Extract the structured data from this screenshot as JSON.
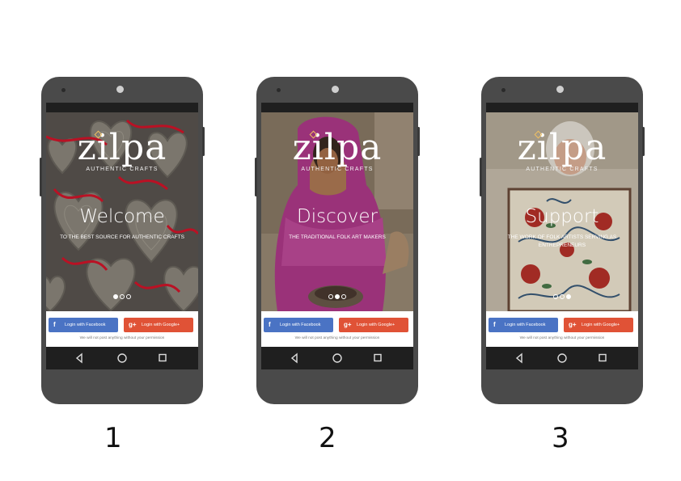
{
  "colors": {
    "phone_body": "#4a4a4a",
    "facebook": "#4a73c4",
    "google": "#e05236"
  },
  "screens": [
    {
      "step": "1",
      "logo": "zilpa",
      "logo_tagline": "AUTHENTIC CRAFTS",
      "headline": "Welcome",
      "subline": "TO THE BEST SOURCE FOR AUTHENTIC CRAFTS",
      "active_dot": 0,
      "facebook_label": "Login with Facebook",
      "google_label": "Login with Google+",
      "disclaimer": "We will not post anything without your permission",
      "facebook_icon": "f",
      "google_icon": "g+"
    },
    {
      "step": "2",
      "logo": "zilpa",
      "logo_tagline": "AUTHENTIC CRAFTS",
      "headline": "Discover",
      "subline": "THE TRADITIONAL FOLK ART MAKERS",
      "active_dot": 1,
      "facebook_label": "Login with Facebook",
      "google_label": "Login with Google+",
      "disclaimer": "We will not post anything without your permission",
      "facebook_icon": "f",
      "google_icon": "g+"
    },
    {
      "step": "3",
      "logo": "zilpa",
      "logo_tagline": "AUTHENTIC CRAFTS",
      "headline": "Support",
      "subline": "THE WORK OF FOLK ARTISTS SERVING AS ENTREPRENEURS",
      "active_dot": 2,
      "facebook_label": "Login with Facebook",
      "google_label": "Login with Google+",
      "disclaimer": "We will not post anything without your permission",
      "facebook_icon": "f",
      "google_icon": "g+"
    }
  ]
}
